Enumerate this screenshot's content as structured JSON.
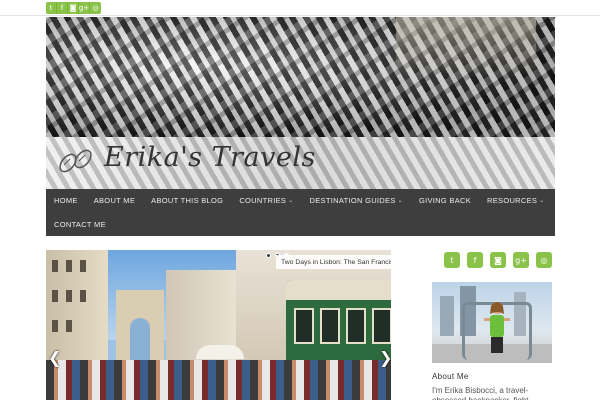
{
  "top_social": {
    "icons": [
      {
        "name": "twitter-icon",
        "glyph": "t"
      },
      {
        "name": "facebook-icon",
        "glyph": "f"
      },
      {
        "name": "instagram-icon",
        "glyph": "◙"
      },
      {
        "name": "googleplus-icon",
        "glyph": "g+"
      },
      {
        "name": "tripadvisor-icon",
        "glyph": "◎"
      }
    ]
  },
  "header": {
    "site_title": "Erika's Travels"
  },
  "nav": {
    "row1": [
      {
        "label": "HOME",
        "dropdown": false
      },
      {
        "label": "ABOUT ME",
        "dropdown": false
      },
      {
        "label": "ABOUT THIS BLOG",
        "dropdown": false
      },
      {
        "label": "COUNTRIES",
        "dropdown": true
      },
      {
        "label": "DESTINATION GUIDES",
        "dropdown": true
      },
      {
        "label": "GIVING BACK",
        "dropdown": false
      },
      {
        "label": "RESOURCES",
        "dropdown": true
      }
    ],
    "row2": [
      {
        "label": "CONTACT ME",
        "dropdown": false
      }
    ],
    "caret": "⌄"
  },
  "slider": {
    "caption": "Two Days in Lisbon: The San Francisco of Europe",
    "dots": 3,
    "active_dot": 2,
    "prev_arrow": "❮",
    "next_arrow": "❯"
  },
  "sidebar": {
    "social_icons": [
      {
        "name": "twitter-icon",
        "glyph": "t"
      },
      {
        "name": "facebook-icon",
        "glyph": "f"
      },
      {
        "name": "instagram-icon",
        "glyph": "◙"
      },
      {
        "name": "googleplus-icon",
        "glyph": "g+"
      },
      {
        "name": "tripadvisor-icon",
        "glyph": "◎"
      }
    ],
    "about_title": "About Me",
    "about_text": "I'm Erika Bisbocci, a travel-obsessed backpacker, fight"
  },
  "colors": {
    "accent_green": "#8bc34a",
    "nav_bg": "#3e3e3e"
  }
}
